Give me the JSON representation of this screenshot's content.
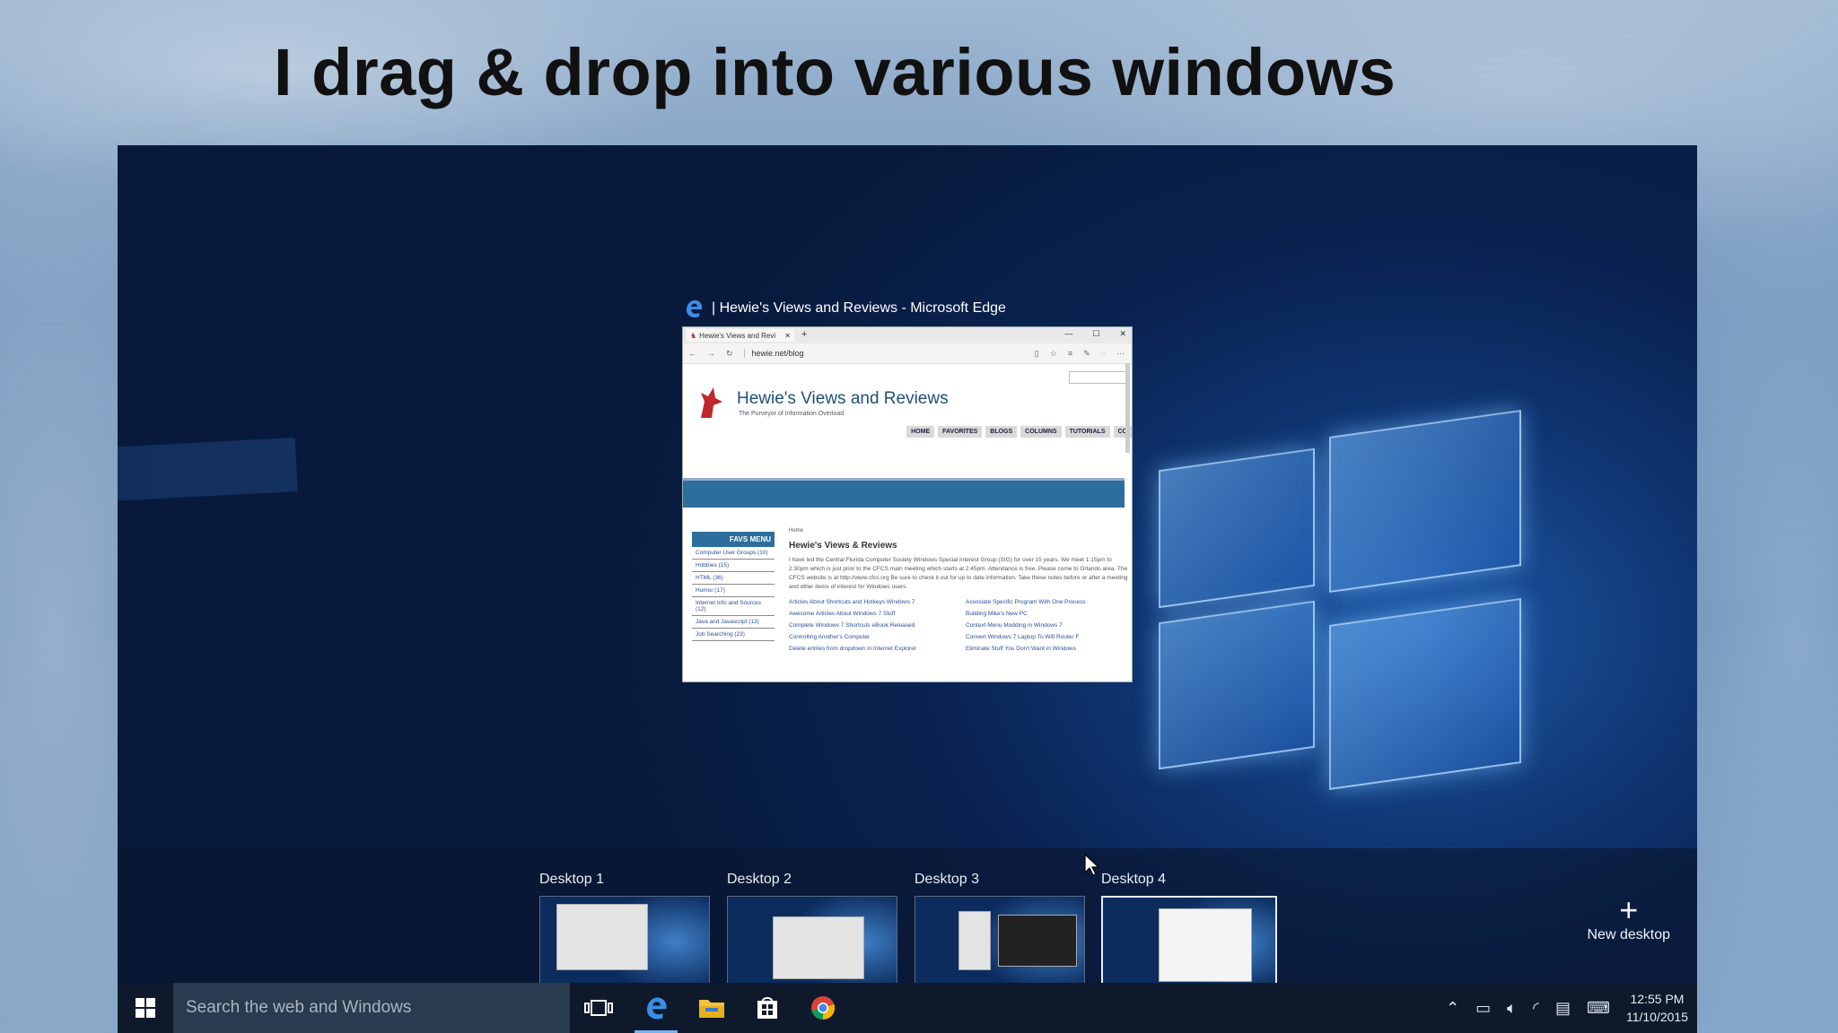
{
  "slide": {
    "title": "I drag & drop into various windows"
  },
  "window_preview": {
    "caption": "| Hewie's Views and Reviews - Microsoft Edge",
    "tab_label": "Hewie's Views and Revi",
    "address": "hewie.net/blog",
    "site_title": "Hewie's Views and Reviews",
    "site_tagline": "The Purveyor of Information Overload",
    "nav": [
      "HOME",
      "FAVORITES",
      "BLOGS",
      "COLUMNS",
      "TUTORIALS",
      "CO"
    ],
    "favs_heading": "FAVS MENU",
    "favs_items": [
      "Computer User Groups (10)",
      "Hobbies (15)",
      "HTML (36)",
      "Humor (17)",
      "Internet Info and Sources (12)",
      "Java and Javascript (13)",
      "Job Searching (23)"
    ],
    "breadcrumb": "Home",
    "content_heading": "Hewie's Views & Reviews",
    "content_text": "I have led the Central Florida Computer Society Windows Special Interest Group (SIG) for over 15 years. We meet 1:15pm to 2:30pm which is just prior to the CFCS main meeting which starts at 2:45pm. Attendance is free. Please come to Orlando area. The CFCS website is at http://www.cfcs.org Be sure to check it out for up to date information. Take these notes before or after a meeting and other items of interest for Windows users.",
    "links": [
      "Articles About Shortcuts and Hotkeys Windows 7",
      "Associate Specific Program With One Process",
      "Awesome Articles About Windows 7 Stuff",
      "Building Mike's New PC",
      "Complete Windows 7 Shortcuts eBook Released",
      "Context Menu Modding in Windows 7",
      "Controlling Another's Computer",
      "Convert Windows 7 Laptop To Wifi Router F",
      "Delete entries from dropdown in Internet Explorer",
      "Eliminate Stuff You Don't Want in Windows"
    ]
  },
  "desktops": [
    {
      "label": "Desktop 1"
    },
    {
      "label": "Desktop 2"
    },
    {
      "label": "Desktop 3"
    },
    {
      "label": "Desktop 4",
      "active": true
    }
  ],
  "new_desktop_label": "New desktop",
  "taskbar": {
    "search_placeholder": "Search the web and Windows",
    "icons": [
      "task-view-icon",
      "edge-icon",
      "file-explorer-icon",
      "store-icon",
      "chrome-icon"
    ],
    "clock_time": "12:55 PM",
    "clock_date": "11/10/2015"
  },
  "colors": {
    "taskbar": "#0e1a2c",
    "accent": "#79b3ec",
    "edge_blue": "#1e74d6"
  }
}
